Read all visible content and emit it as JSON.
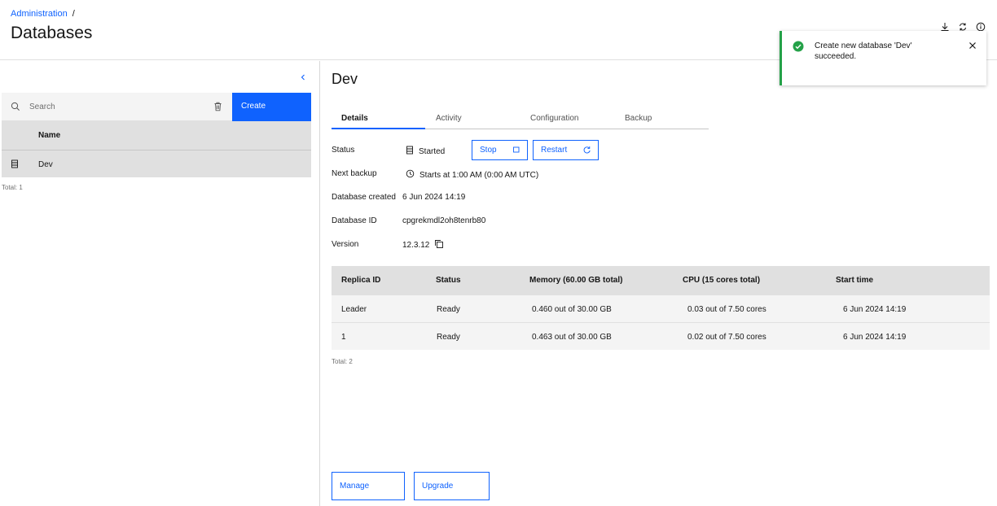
{
  "header": {
    "breadcrumb_link": "Administration",
    "breadcrumb_sep": "/",
    "title": "Databases",
    "actions": [
      "download-icon",
      "refresh-icon",
      "info-icon"
    ]
  },
  "toast": {
    "message": "Create new database 'Dev' succeeded.",
    "status_color": "#24a148"
  },
  "list": {
    "search_placeholder": "Search",
    "search_value": "",
    "create_label": "Create",
    "column_name": "Name",
    "rows": [
      {
        "name": "Dev",
        "icon": "database-icon"
      }
    ],
    "total": "Total: 1"
  },
  "detail": {
    "title": "Dev",
    "tabs": [
      {
        "label": "Details",
        "active": true
      },
      {
        "label": "Activity",
        "active": false
      },
      {
        "label": "Configuration",
        "active": false
      },
      {
        "label": "Backup",
        "active": false
      }
    ],
    "status_label": "Status",
    "status_value": "Started",
    "stop_label": "Stop",
    "restart_label": "Restart",
    "next_backup_label": "Next backup",
    "next_backup_value": "Starts at 1:00 AM (0:00 AM UTC)",
    "created_label": "Database created",
    "created_value": "6 Jun 2024 14:19",
    "id_label": "Database ID",
    "id_value": "cpgrekmdl2oh8tenrb80",
    "version_label": "Version",
    "version_value": "12.3.12",
    "replicas": {
      "columns": [
        "Replica ID",
        "Status",
        "Memory (60.00 GB total)",
        "CPU (15 cores total)",
        "Start time"
      ],
      "rows": [
        [
          "Leader",
          "Ready",
          "0.460 out of 30.00 GB",
          "0.03 out of 7.50 cores",
          "6 Jun 2024 14:19"
        ],
        [
          "1",
          "Ready",
          "0.463 out of 30.00 GB",
          "0.02 out of 7.50 cores",
          "6 Jun 2024 14:19"
        ]
      ],
      "total": "Total: 2"
    },
    "manage_label": "Manage",
    "upgrade_label": "Upgrade"
  },
  "colors": {
    "accent": "#0f62fe",
    "success": "#24a148"
  }
}
